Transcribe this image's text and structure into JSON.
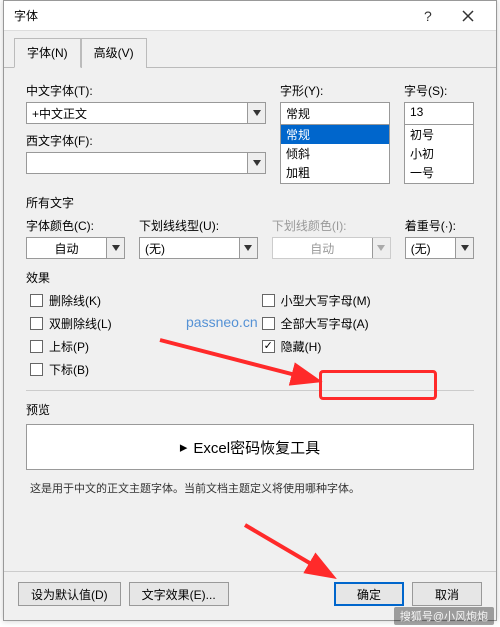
{
  "dialog": {
    "title": "字体",
    "tabs": {
      "font": "字体(N)",
      "advanced": "高级(V)"
    }
  },
  "labels": {
    "zh_font": "中文字体(T):",
    "west_font": "西文字体(F):",
    "style": "字形(Y):",
    "size": "字号(S):",
    "allText": "所有文字",
    "fontColor": "字体颜色(C):",
    "underlineStyle": "下划线线型(U):",
    "underlineColor": "下划线颜色(I):",
    "emphasis": "着重号(·):",
    "effects": "效果",
    "preview": "预览"
  },
  "values": {
    "zh_font": "+中文正文",
    "west_font": "",
    "style": "常规",
    "size": "13",
    "fontColor": "自动",
    "underlineStyle": "(无)",
    "underlineColor": "自动",
    "emphasis": "(无)"
  },
  "styleOptions": [
    "常规",
    "倾斜",
    "加粗"
  ],
  "sizeOptions": [
    "初号",
    "小初",
    "一号"
  ],
  "effects": {
    "strikethrough": "删除线(K)",
    "doubleStrike": "双删除线(L)",
    "superscript": "上标(P)",
    "subscript": "下标(B)",
    "smallCaps": "小型大写字母(M)",
    "allCaps": "全部大写字母(A)",
    "hidden": "隐藏(H)"
  },
  "preview": {
    "text": "Excel密码恢复工具",
    "hint": "这是用于中文的正文主题字体。当前文档主题定义将使用哪种字体。"
  },
  "buttons": {
    "setDefault": "设为默认值(D)",
    "textEffects": "文字效果(E)...",
    "ok": "确定",
    "cancel": "取消"
  },
  "watermark": "passneo.cn",
  "credit": "搜狐号@小风炮炮"
}
